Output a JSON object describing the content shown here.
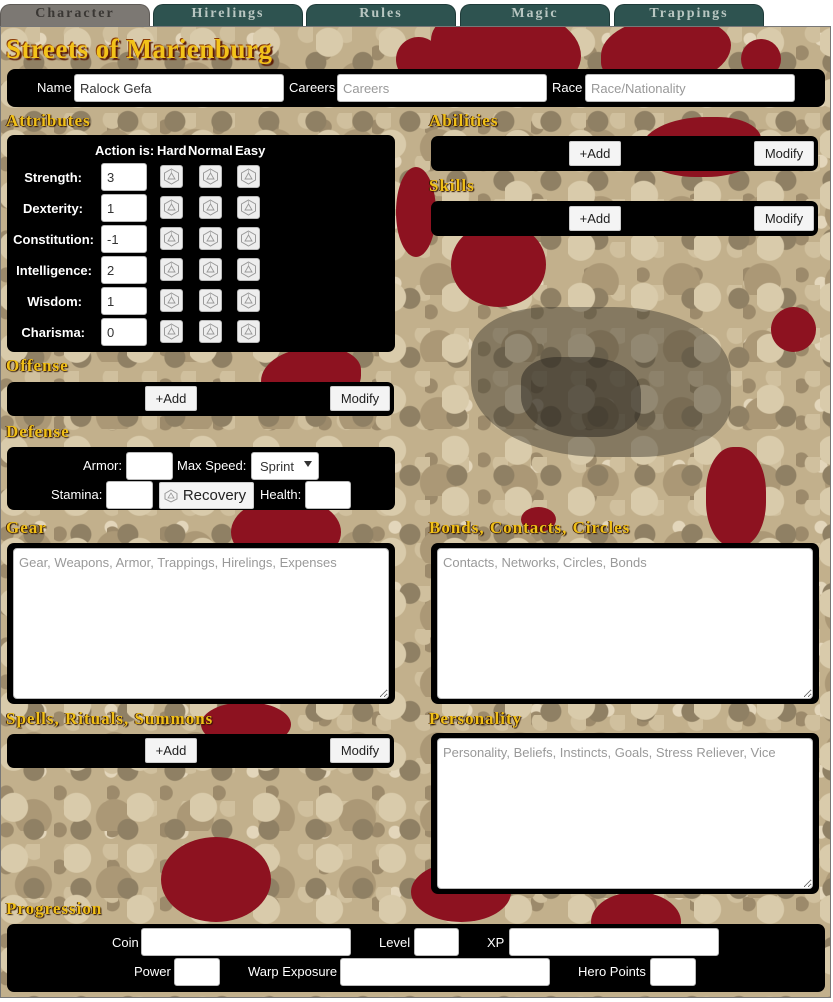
{
  "tabs": [
    "Character",
    "Hirelings",
    "Rules",
    "Magic",
    "Trappings"
  ],
  "title": "Streets of Marienburg",
  "identity": {
    "name_label": "Name",
    "name_value": "Ralock Gefa",
    "careers_label": "Careers",
    "careers_placeholder": "Careers",
    "race_label": "Race",
    "race_placeholder": "Race/Nationality"
  },
  "attributes": {
    "heading": "Attributes",
    "action_label": "Action is:",
    "hard": "Hard",
    "normal": "Normal",
    "easy": "Easy",
    "rows": [
      {
        "label": "Strength:",
        "value": "3"
      },
      {
        "label": "Dexterity:",
        "value": "1"
      },
      {
        "label": "Constitution:",
        "value": "-1"
      },
      {
        "label": "Intelligence:",
        "value": "2"
      },
      {
        "label": "Wisdom:",
        "value": "1"
      },
      {
        "label": "Charisma:",
        "value": "0"
      }
    ]
  },
  "abilities": {
    "heading": "Abilities",
    "add": "+Add",
    "modify": "Modify"
  },
  "skills": {
    "heading": "Skills",
    "add": "+Add",
    "modify": "Modify"
  },
  "offense": {
    "heading": "Offense",
    "add": "+Add",
    "modify": "Modify"
  },
  "defense": {
    "heading": "Defense",
    "armor_label": "Armor:",
    "max_speed_label": "Max Speed:",
    "speed_selected": "Sprint",
    "stamina_label": "Stamina:",
    "recovery": "Recovery",
    "health_label": "Health:"
  },
  "gear": {
    "heading": "Gear",
    "placeholder": "Gear, Weapons, Armor, Trappings, Hirelings, Expenses"
  },
  "bonds": {
    "heading": "Bonds, Contacts, Circles",
    "placeholder": "Contacts, Networks, Circles, Bonds"
  },
  "spells": {
    "heading": "Spells, Rituals, Summons",
    "add": "+Add",
    "modify": "Modify"
  },
  "personality": {
    "heading": "Personality",
    "placeholder": "Personality, Beliefs, Instincts, Goals, Stress Reliever, Vice"
  },
  "progression": {
    "heading": "Progression",
    "coin": "Coin",
    "level": "Level",
    "xp": "XP",
    "power": "Power",
    "warp": "Warp Exposure",
    "hero": "Hero Points"
  },
  "colors": {
    "heading_gold": "#f0c018",
    "blood": "#8d1220",
    "tab_teal": "#2e5350",
    "tab_active": "#7c7873",
    "panel": "#000000"
  },
  "icons": {
    "die": "d20-die-icon",
    "caret": "caret-down-icon"
  }
}
